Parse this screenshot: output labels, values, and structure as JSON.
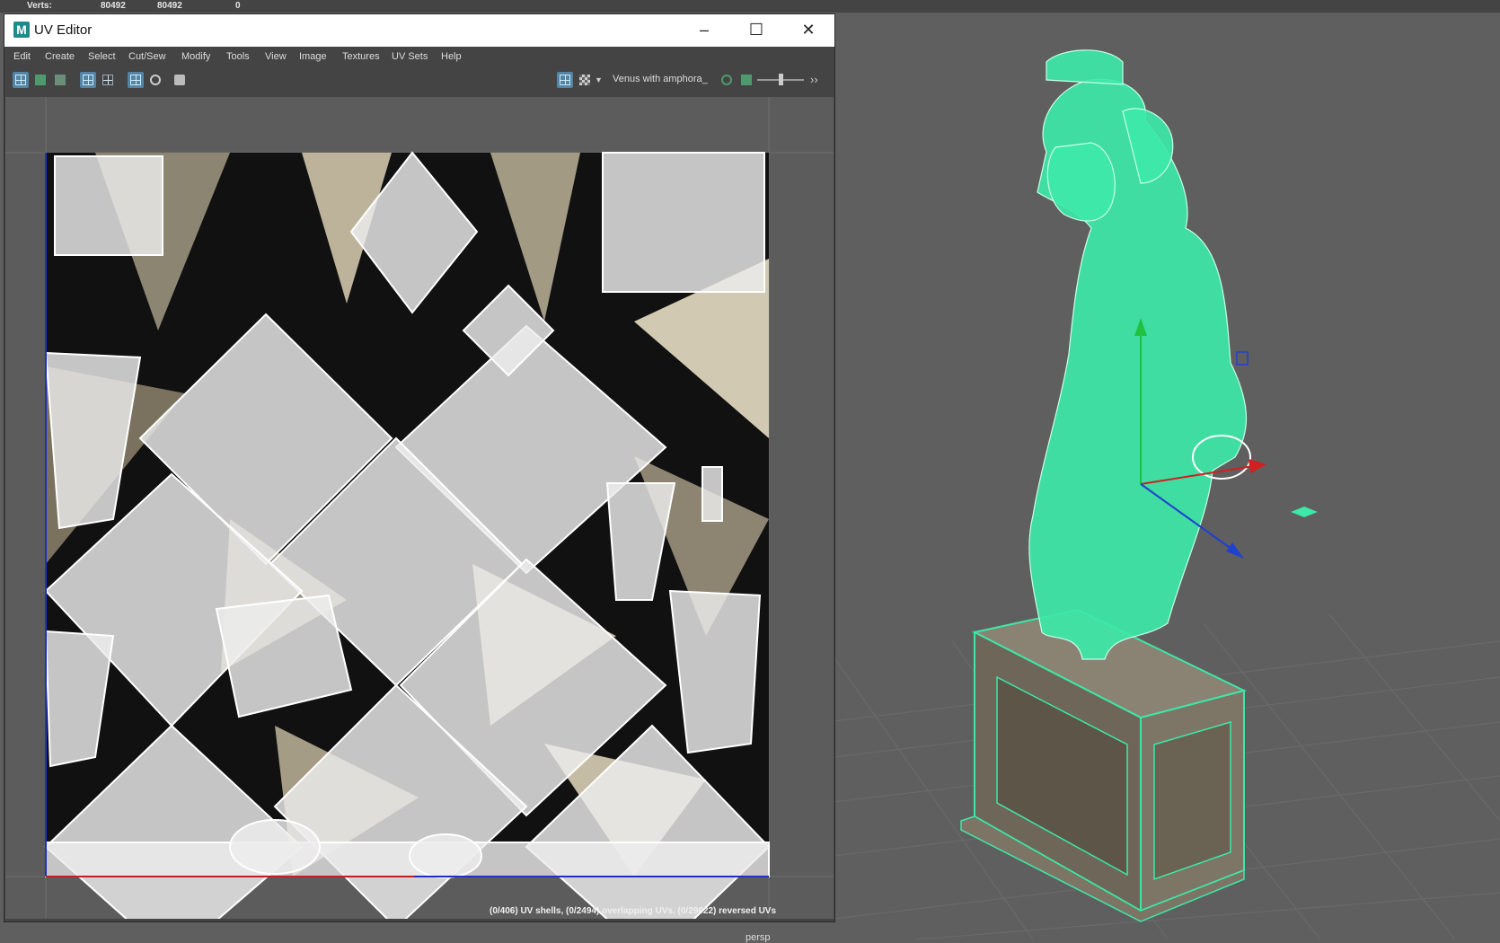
{
  "hud": {
    "verts_label": "Verts:",
    "verts_a": "80492",
    "verts_b": "80492",
    "verts_c": "0"
  },
  "window": {
    "logo": "M",
    "title": "UV Editor",
    "minimize_icon": "minimize-icon",
    "maximize_icon": "maximize-icon",
    "close_icon": "close-icon"
  },
  "menu": [
    "Edit",
    "Create",
    "Select",
    "Cut/Sew",
    "Modify",
    "Tools",
    "View",
    "Image",
    "Textures",
    "UV Sets",
    "Help"
  ],
  "toolbar": {
    "texture_name": "Venus with amphora_",
    "icons": [
      "uv-shell-icon",
      "uv-grid-icon",
      "uv-grid-alt-icon",
      "uv-frame-icon",
      "uv-frame-alt-icon",
      "grid-toggle-icon",
      "shaded-icon",
      "snapshot-icon",
      "image-display-icon",
      "checker-icon",
      "dropdown-arrow-icon",
      "texture-link-icon",
      "image-icon",
      "exposure-slider",
      "forward-icon"
    ]
  },
  "status_text": "(0/406) UV shells, (0/2494) overlapping UVs, (0/29622) reversed UVs",
  "viewport": {
    "camera_label": "persp",
    "wire_color": "#3de8a8",
    "background": "#5f5f5f"
  },
  "colors": {
    "axis_x": "#d02020",
    "axis_y": "#20c040",
    "axis_z": "#2040d0",
    "uv_wire": "#ffffff"
  }
}
